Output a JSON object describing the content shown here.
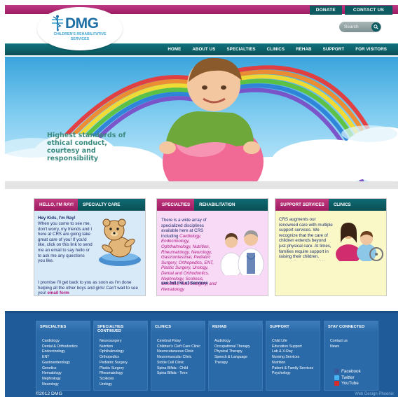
{
  "header": {
    "donate": "DONATE",
    "contact": "CONTACT US",
    "logo": {
      "name": "DMG",
      "tagline": "CHILDREN'S REHABILITATIVE SERVICES"
    },
    "search": {
      "placeholder": "Search"
    }
  },
  "nav": [
    "HOME",
    "ABOUT US",
    "SPECIALTIES",
    "CLINICS",
    "REHAB",
    "SUPPORT",
    "FOR VISITORS"
  ],
  "hero": {
    "tagline": "Highest standards of ethical conduct, courtesy and responsibility"
  },
  "boxes": {
    "ray": {
      "tab_active": "HELLO, I'M RAY!",
      "tab_other": "SPECIALTY CARE",
      "heading": "Hey Kids, I'm Ray!",
      "text": "When you come to see me, don't worry, my friends and I here at CRS are going take great care of you! If you'd like, click on this link to send me an email to say hello or to ask me any questions you like.",
      "text2": "I promise I'll get back to you as soon as I'm done helping all the other boys and girls! Can't wait to see you!",
      "link": "email form"
    },
    "specialties": {
      "tab_active": "SPECIALTIES",
      "tab_other": "REHABILITATION",
      "intro": "There is a wide array of specialized disciplines available here at CRS including",
      "list": "Cardiology, Endocrinology, Ophthalmology, Nutrition, Rheumatology, Neurology, Gastrointestinal, Pediatric Surgery, Orthopedics, ENT, Plastic Surgery, Urology, Dental and Orthodontics, Nephrology, Scoliosis, Genetics, Neurosurgery, and Hematology",
      "link": "see full list of Services"
    },
    "support": {
      "tab_active": "SUPPORT SERVICES",
      "tab_other": "CLINICS",
      "text": "CRS augments our renowned care with multiple support services. We recognize that the care of children extends beyond just physical care. At times, families require support in raising their children, especially when a child has complex health care needs. Also available are Education Support, Psychology, Patient & Family Services, Nursing, Lab & X-Ray, Child Life, and Nutrition"
    }
  },
  "footer": {
    "columns": [
      {
        "title": "SPECIALTIES",
        "items": [
          "Cardiology",
          "Dental & Orthodontics",
          "Endocrinology",
          "ENT",
          "Gastroenterology",
          "Genetics",
          "Hematology",
          "Nephrology",
          "Neurology"
        ]
      },
      {
        "title": "SPECIALTIES CONTINUED",
        "items": [
          "Neurosurgery",
          "Nutrition",
          "Ophthalmology",
          "Orthopedics",
          "Pediatric Surgery",
          "Plastic Surgery",
          "Rheumatology",
          "Scoliosis",
          "Urology"
        ]
      },
      {
        "title": "CLINICS",
        "items": [
          "Cerebral Palsy",
          "Children's Cleft Care Clinic",
          "Neurocutaneous Clinic",
          "Neuromuscular Clinic",
          "Sickle Cell Clinic",
          "Spina Bifida - Child",
          "Spina Bifida - Teen"
        ]
      },
      {
        "title": "REHAB",
        "items": [
          "Audiology",
          "Occupational Therapy",
          "Physical Therapy",
          "Speech & Language",
          "Therapy"
        ]
      },
      {
        "title": "SUPPORT",
        "items": [
          "Child Life",
          "Education Support",
          "Lab & X-Ray",
          "Nursing Services",
          "Nutrition",
          "Patient & Family Services",
          "Psychology"
        ]
      },
      {
        "title": "STAY CONNECTED",
        "items": [
          "Contact us",
          "News"
        ]
      }
    ],
    "social": [
      "Facebook",
      "Twitter",
      "YouTube"
    ],
    "copyright": "©2012 DMG",
    "credit": "Web Design Phoenix"
  },
  "colors": {
    "magenta": "#a81f6a",
    "teal": "#0d5b61",
    "footer_blue": "#1e5b98"
  }
}
